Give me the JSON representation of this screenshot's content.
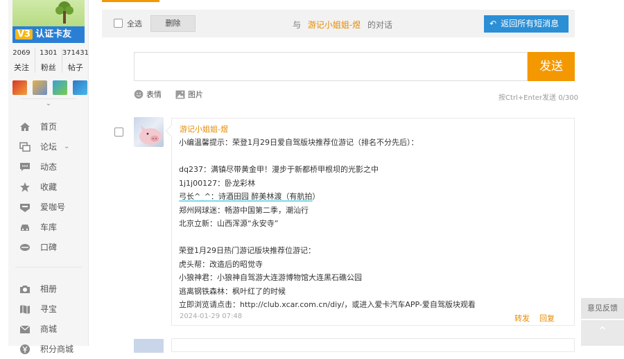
{
  "sidebar": {
    "verify_tag": "V3",
    "verify_text": "认证卡友",
    "stats": [
      {
        "num": "2069",
        "label": "关注"
      },
      {
        "num": "1301",
        "label": "粉丝"
      },
      {
        "num": "371431",
        "label": "帖子"
      }
    ],
    "collapse_icon": "chevron-down-icon",
    "nav_primary": [
      {
        "label": "首页",
        "icon": "home-icon"
      },
      {
        "label": "论坛",
        "icon": "forum-icon"
      },
      {
        "label": "动态",
        "icon": "activity-icon"
      },
      {
        "label": "收藏",
        "icon": "star-icon"
      },
      {
        "label": "爱咖号",
        "icon": "aika-icon"
      },
      {
        "label": "车库",
        "icon": "car-icon"
      },
      {
        "label": "口碑",
        "icon": "mouth-icon"
      }
    ],
    "nav_secondary": [
      {
        "label": "相册",
        "icon": "camera-icon"
      },
      {
        "label": "寻宝",
        "icon": "map-icon"
      },
      {
        "label": "商城",
        "icon": "mail-icon"
      },
      {
        "label": "积分商城",
        "icon": "yen-icon"
      }
    ]
  },
  "toolbar": {
    "select_all": "全选",
    "delete": "删除",
    "conv_prefix": "与",
    "conv_name": "游记小姐姐-煜",
    "conv_suffix": "的对话",
    "back": "返回所有短消息"
  },
  "compose": {
    "send": "发送",
    "emoji": "表情",
    "image": "图片",
    "counter": "按Ctrl+Enter发送 0/300"
  },
  "message": {
    "sender": "游记小姐姐-煜",
    "lines": [
      "小编温馨提示：荣登1月29日爱自驾版块推荐位游记（排名不分先后）：",
      "",
      "dq237：满镇尽带黄金甲！漫步于新都桥甲根坝的光影之中",
      "1j1j00127：卧龙彩林",
      "弓长^_^：诗酒田园 醉美林渡（有航拍）",
      "郑州网球迷：畅游中国第二季，潮汕行",
      "北京立新：山西浑源“永安寺”",
      "",
      "荣登1月29日热门游记版块推荐位游记：",
      "虎头帮：改造后的昭觉寺",
      "小狼神君：小狼神自驾游大连游博物馆大连黑石礁公园",
      "逃离钢铁森林：枫叶红了的时候",
      "立即浏览请点击：http://club.xcar.com.cn/diy/，或进入爱卡汽车APP-爱自驾版块观看"
    ],
    "time": "2024-01-29 07:48",
    "forward": "转发",
    "reply": "回复"
  },
  "float": {
    "feedback": "意见反馈",
    "totop_icon": "arrow-up-icon"
  },
  "colors": {
    "accent": "#f39800",
    "link": "#e58a00",
    "primary_button": "#2b8fd6"
  }
}
